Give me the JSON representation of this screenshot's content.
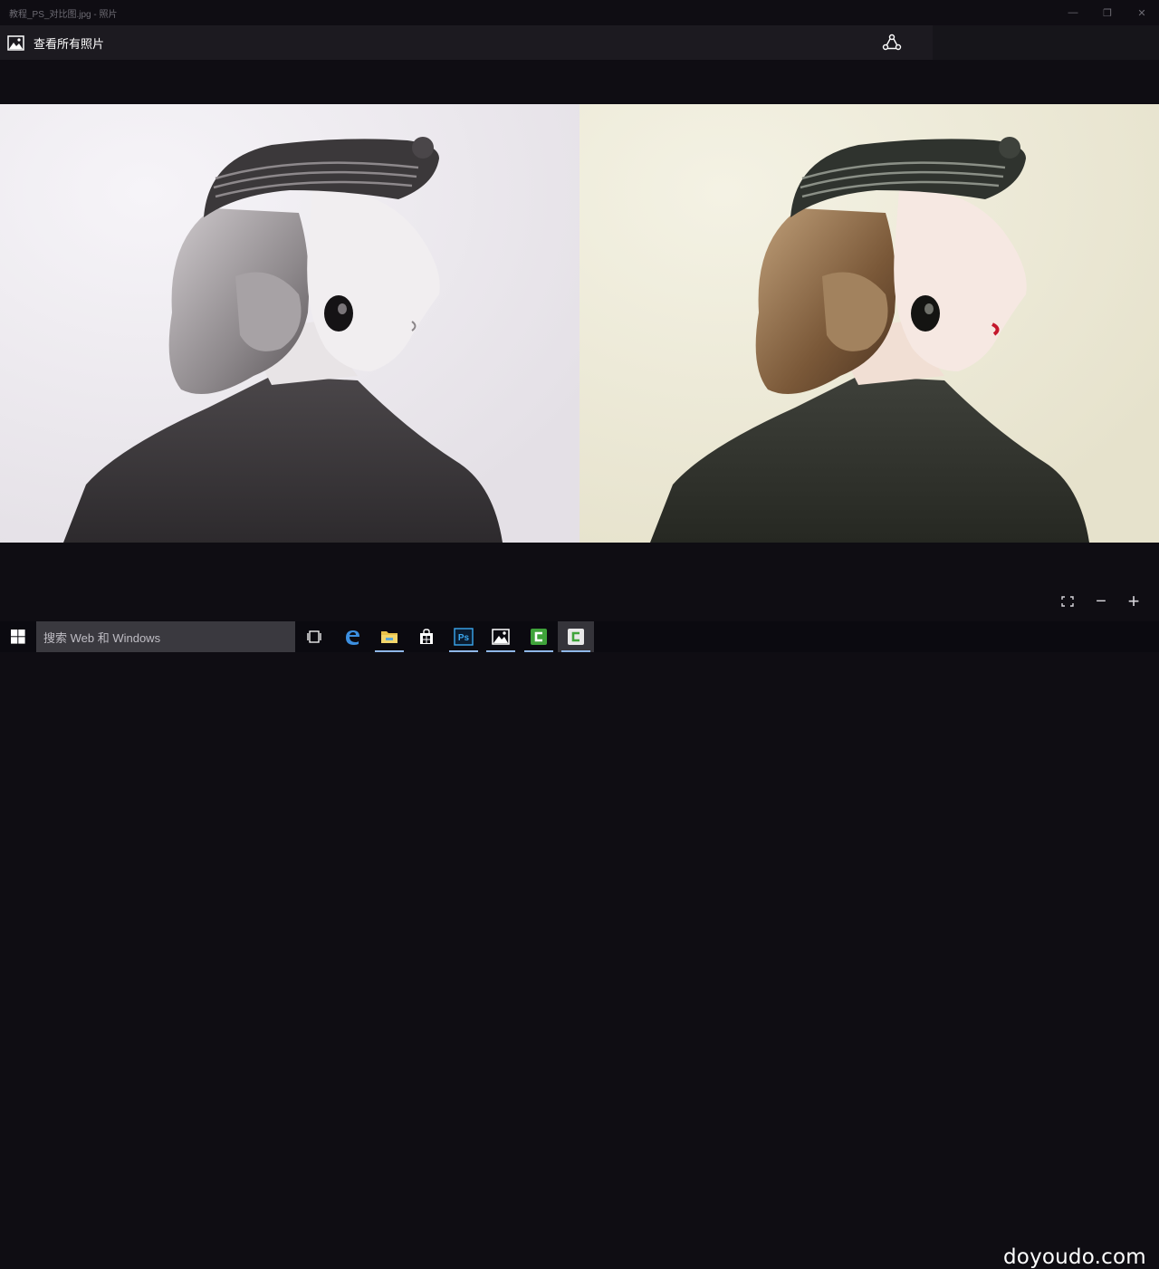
{
  "window": {
    "title": "教程_PS_对比图.jpg - 照片"
  },
  "titlebar": {
    "minimize": "—",
    "maximize": "❐",
    "close": "✕"
  },
  "appbar": {
    "all_photos_label": "查看所有照片",
    "icon": "photos-icon",
    "share_icon": "share-icon"
  },
  "view_controls": {
    "fullscreen_icon": "fullscreen-icon",
    "zoom_out": "−",
    "zoom_in": "+"
  },
  "taskbar": {
    "search_placeholder": "搜索 Web 和 Windows",
    "apps": [
      "task-view-icon",
      "edge-icon",
      "file-explorer-icon",
      "store-icon",
      "photoshop-icon",
      "photos-app-icon",
      "camtasia-icon",
      "camtasia-recorder-icon"
    ],
    "ps_label": "Ps"
  },
  "watermark": "doyoudo.com",
  "colors": {
    "accent": "#8fb7e8",
    "bg": "#0f0d13",
    "appbar": "#1c1a20",
    "left_bg": "#eae6ec",
    "right_bg": "#ece8d6"
  }
}
